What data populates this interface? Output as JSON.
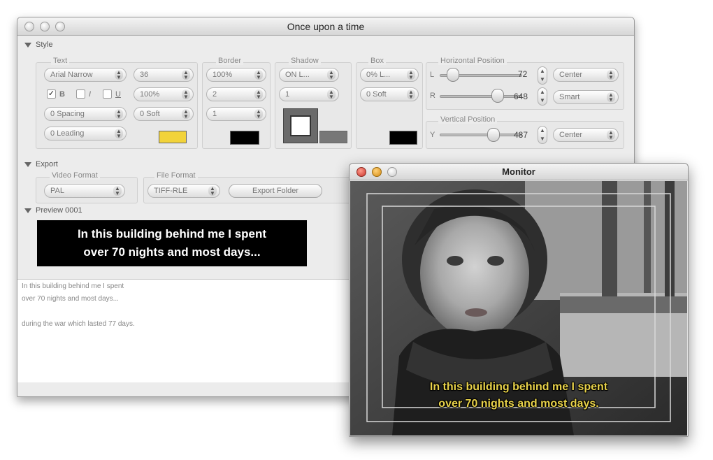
{
  "main_window": {
    "title": "Once upon a time",
    "style_section": {
      "label": "Style",
      "text_group": {
        "label": "Text",
        "font": "Arial Narrow",
        "size": "36",
        "bold_label": "B",
        "bold_checked": true,
        "italic_label": "I",
        "underline_label": "U",
        "scale": "100%",
        "spacing": "0 Spacing",
        "soft": "0 Soft",
        "leading": "0 Leading",
        "color": "#f2d33a"
      },
      "border_group": {
        "label": "Border",
        "opacity": "100%",
        "width": "2",
        "soft": "1",
        "color": "#000000"
      },
      "shadow_group": {
        "label": "Shadow",
        "mode": "ON L...",
        "offset": "1",
        "color": "#777777"
      },
      "box_group": {
        "label": "Box",
        "mode": "0% L...",
        "soft": "0 Soft",
        "color": "#000000"
      },
      "horizontal_position": {
        "label": "Horizontal Position",
        "l_label": "L",
        "l_value": "72",
        "r_label": "R",
        "r_value": "648",
        "align": "Center",
        "wrap": "Smart"
      },
      "vertical_position": {
        "label": "Vertical Position",
        "y_label": "Y",
        "y_value": "487",
        "align": "Center"
      }
    },
    "export_section": {
      "label": "Export",
      "video_format_label": "Video Format",
      "video_format": "PAL",
      "file_format_label": "File Format",
      "file_format": "TIFF-RLE",
      "export_folder_button": "Export Folder"
    },
    "preview_section": {
      "label": "Preview 0001",
      "line1": "In this building behind me I spent",
      "line2": "over 70 nights and most days..."
    },
    "text_lines": [
      "In this building behind me I spent",
      "over 70 nights and most days...",
      "",
      "during the war which lasted 77 days."
    ]
  },
  "monitor_window": {
    "title": "Monitor",
    "subtitle_line1": "In this building behind me I spent",
    "subtitle_line2": "over 70 nights and most days."
  }
}
